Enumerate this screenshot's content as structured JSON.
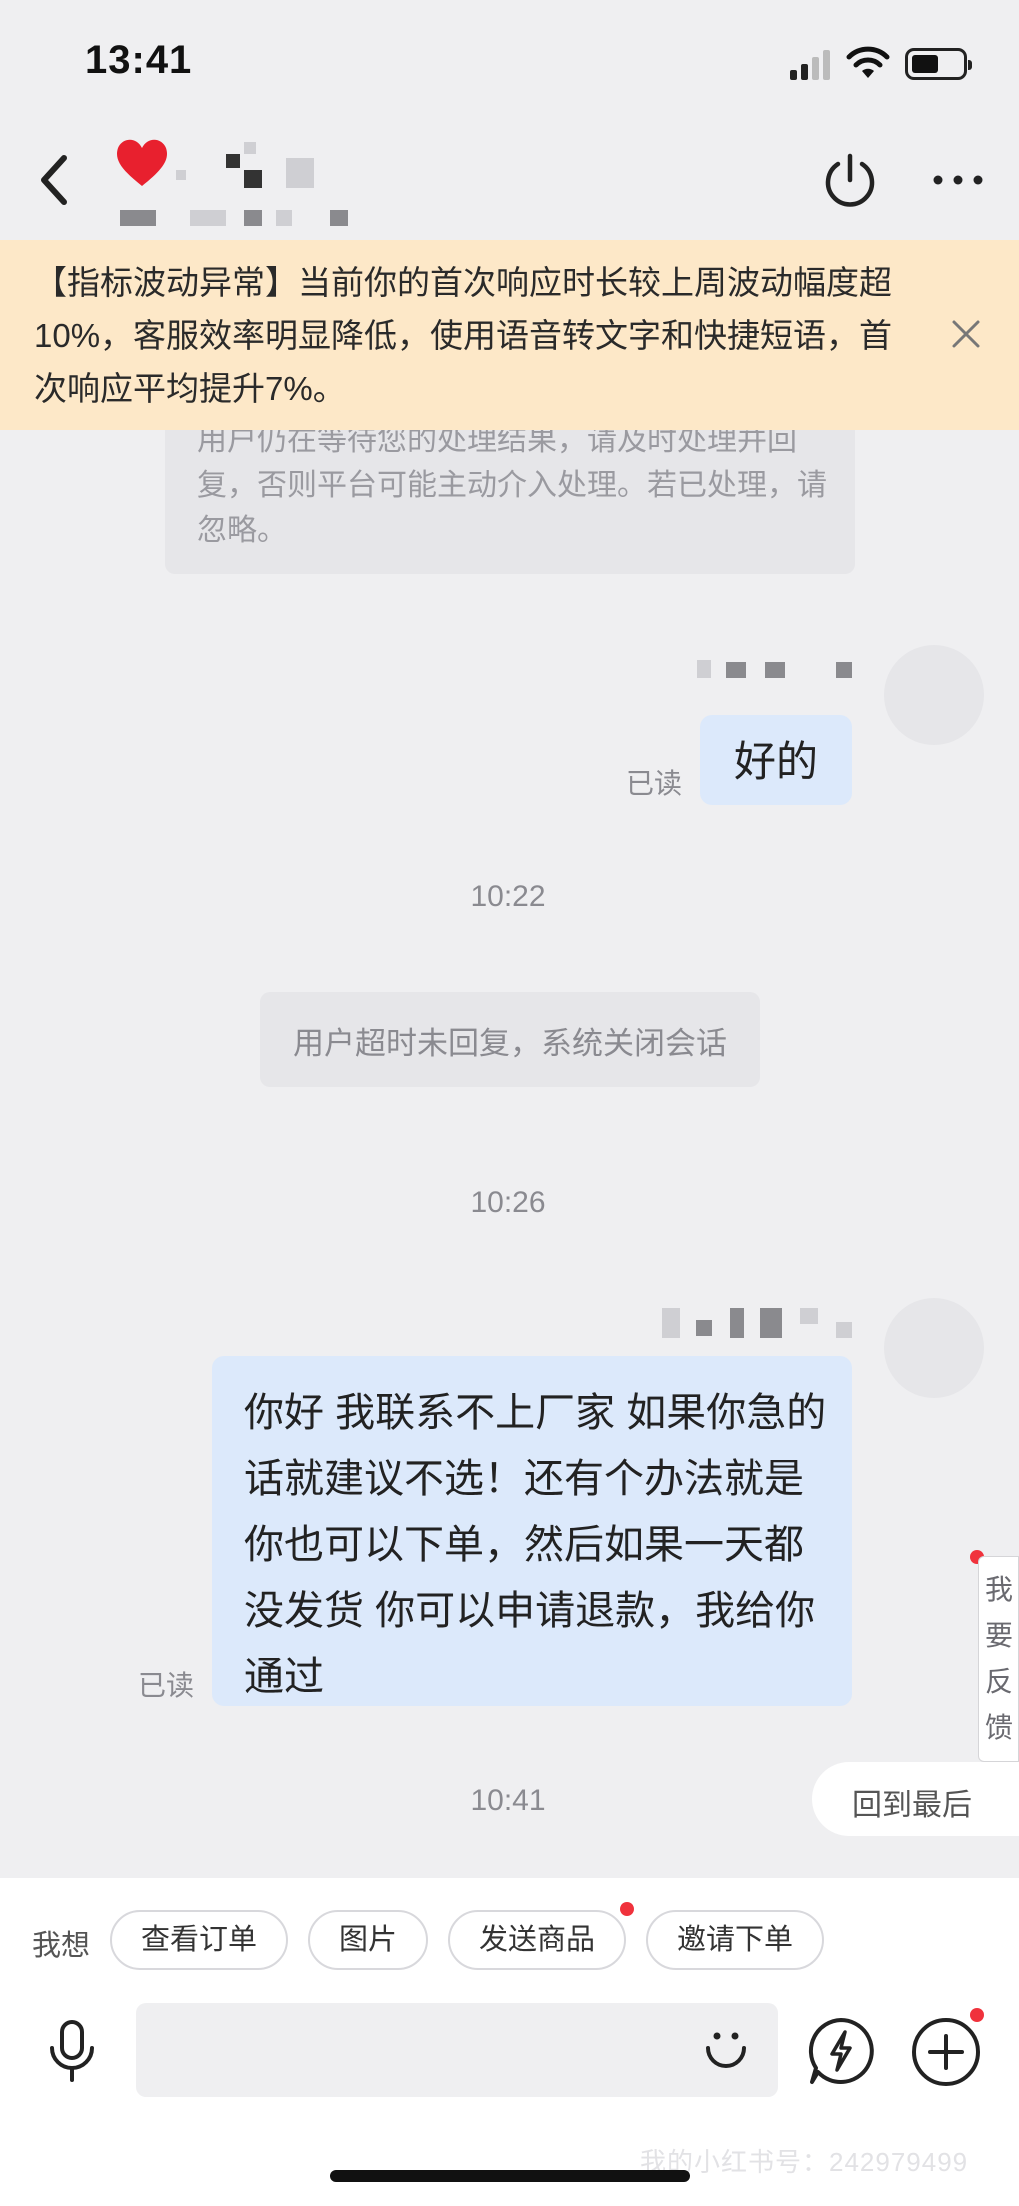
{
  "status_bar": {
    "time": "13:41"
  },
  "banner": {
    "text": "【指标波动异常】当前你的首次响应时长较上周波动幅度超10%，客服效率明显降低，使用语音转文字和快捷短语，首次响应平均提升7%。"
  },
  "messages": {
    "system_reminder": "用户仍在等待您的处理结果，请及时处理并回复，否则平台可能主动介入处理。若已处理，请忽略。",
    "bubble_1": {
      "text": "好的",
      "status": "已读"
    },
    "time_1": "10:22",
    "system_close": "用户超时未回复，系统关闭会话",
    "time_2": "10:26",
    "bubble_2": {
      "text": "你好 我联系不上厂家 如果你急的话就建议不选！还有个办法就是你也可以下单，然后如果一天都没发货 你可以申请退款，我给你通过",
      "status": "已读"
    },
    "time_3": "10:41"
  },
  "feedback_tab": "我要反馈",
  "back_to_latest": "回到最后",
  "quick_actions": {
    "label": "我想",
    "chips": [
      "查看订单",
      "图片",
      "发送商品",
      "邀请下单"
    ]
  },
  "input": {
    "placeholder": ""
  },
  "watermark": "我的小红书号：242979499",
  "colors": {
    "banner_bg": "#fde8c8",
    "bubble_bg": "#dce9fb",
    "badge": "#f0323c"
  }
}
